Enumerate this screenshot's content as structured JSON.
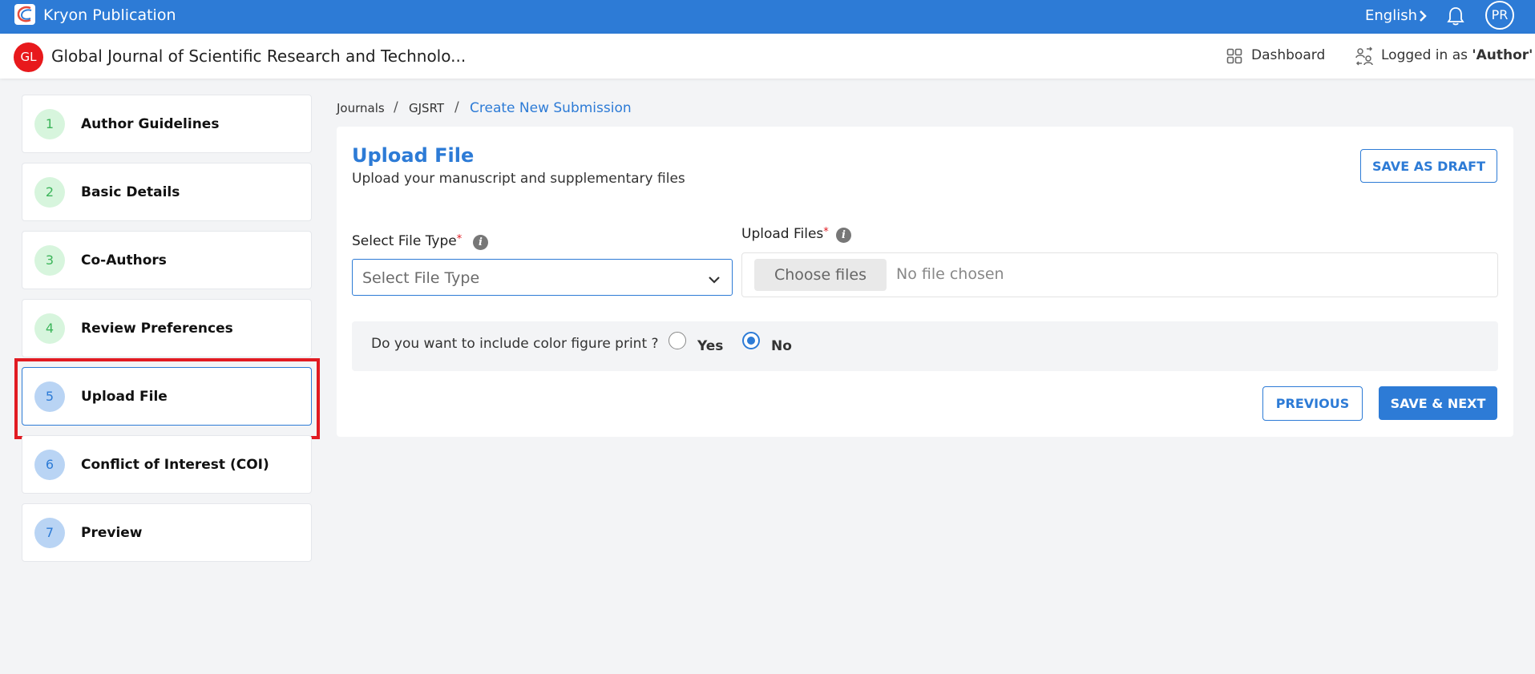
{
  "topbar": {
    "brand": "Kryon Publication",
    "language": "English",
    "avatar_initials": "PR",
    "accent_color": "#2d7bd6"
  },
  "header": {
    "journal_logo": "GL",
    "journal_title": "Global Journal of Scientific Research and Technolo...",
    "dashboard_label": "Dashboard",
    "logged_in_prefix": "Logged in as ",
    "logged_in_role": "'Author'"
  },
  "steps": [
    {
      "num": "1",
      "label": "Author Guidelines",
      "state": "complete"
    },
    {
      "num": "2",
      "label": "Basic Details",
      "state": "complete"
    },
    {
      "num": "3",
      "label": "Co-Authors",
      "state": "complete"
    },
    {
      "num": "4",
      "label": "Review Preferences",
      "state": "complete"
    },
    {
      "num": "5",
      "label": "Upload File",
      "state": "active"
    },
    {
      "num": "6",
      "label": "Conflict of Interest (COI)",
      "state": "pending"
    },
    {
      "num": "7",
      "label": "Preview",
      "state": "pending"
    }
  ],
  "breadcrumb": {
    "items": [
      "Journals",
      "GJSRT",
      "Create New Submission"
    ],
    "separator": "/"
  },
  "card": {
    "title": "Upload File",
    "subtitle": "Upload your manuscript and supplementary files",
    "save_draft": "SAVE AS DRAFT",
    "file_type_label": "Select File Type",
    "file_type_placeholder": "Select File Type",
    "upload_label": "Upload Files",
    "required_mark": "*",
    "choose_files": "Choose files",
    "no_file": "No file chosen",
    "color_question": "Do you want to include color figure print ?",
    "yes_label": "Yes",
    "no_label": "No",
    "selected_option": "No",
    "previous": "PREVIOUS",
    "save_next": "SAVE & NEXT"
  },
  "icons": {
    "logo": "kryon-logo-icon",
    "lang_chevron": "chevron-right-icon",
    "bell": "bell-icon",
    "dashboard": "grid-icon",
    "user_switch": "user-switch-icon",
    "info": "info-icon",
    "select_chevron": "chevron-down-icon"
  }
}
